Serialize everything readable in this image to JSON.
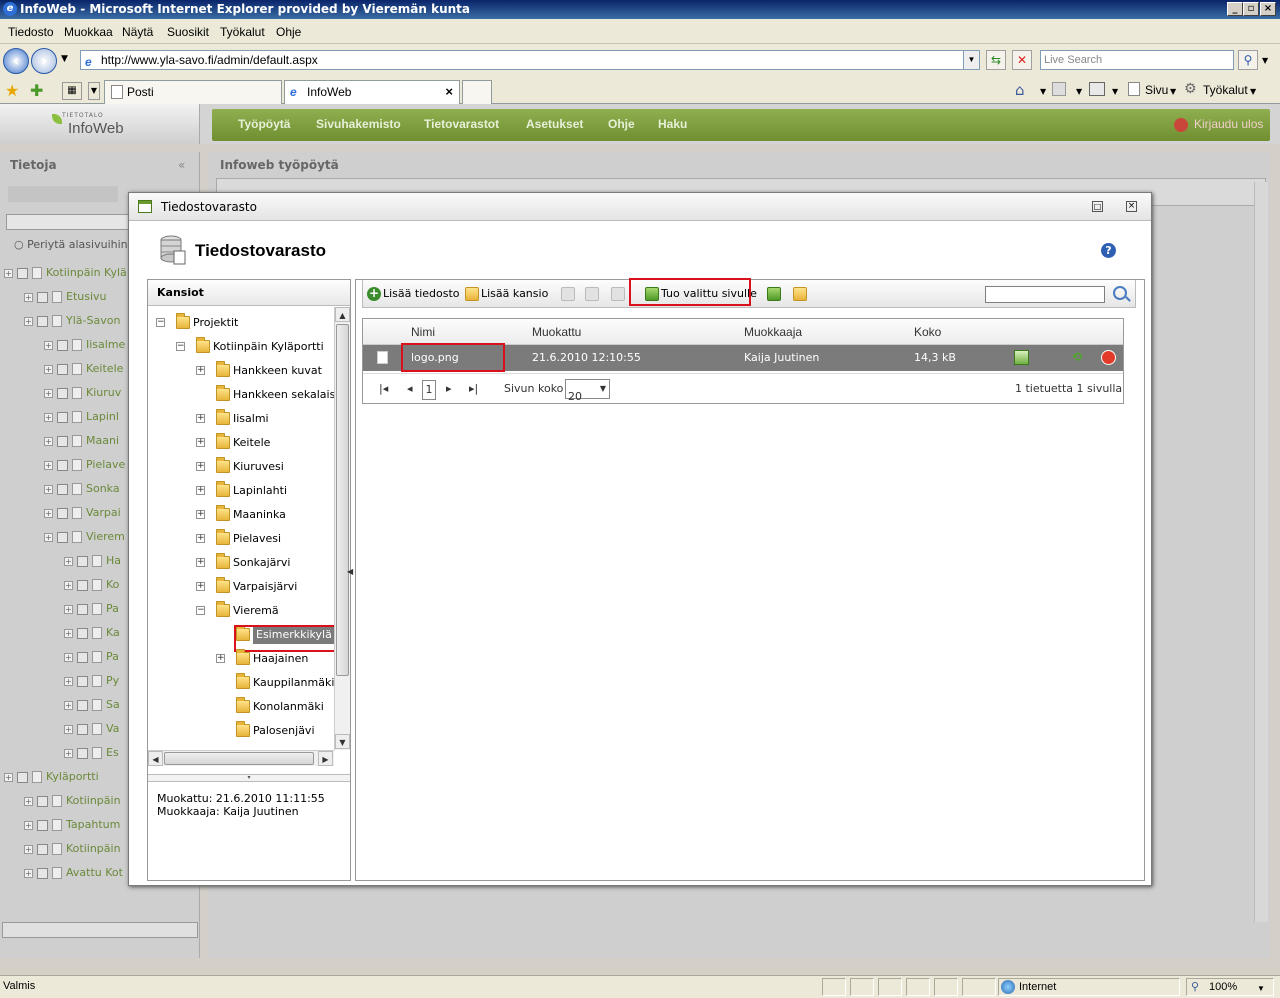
{
  "window": {
    "title": "InfoWeb - Microsoft Internet Explorer provided by Vieremän kunta"
  },
  "menu": [
    "Tiedosto",
    "Muokkaa",
    "Näytä",
    "Suosikit",
    "Työkalut",
    "Ohje"
  ],
  "address": {
    "url": "http://www.yla-savo.fi/admin/default.aspx",
    "search_placeholder": "Live Search"
  },
  "tabs": [
    {
      "label": "Posti"
    },
    {
      "label": "InfoWeb"
    }
  ],
  "ietools": {
    "page": "Sivu",
    "tools": "Työkalut"
  },
  "app": {
    "logo_small": "TIETOTALO",
    "logo_main": "InfoWeb",
    "nav": [
      "Työpöytä",
      "Sivuhakemisto",
      "Tietovarastot",
      "Asetukset",
      "Ohje",
      "Haku"
    ],
    "logout": "Kirjaudu ulos"
  },
  "leftpanel": {
    "title": "Tietoja",
    "inherit": "Periytä alasivuihin",
    "items": [
      "Kotiinpäin Kylä",
      "Etusivu",
      "Ylä-Savon",
      "Iisalme",
      "Keitele",
      "Kiuruv",
      "Lapinl",
      "Maani",
      "Pielave",
      "Sonka",
      "Varpai",
      "Vierem",
      "Ha",
      "Ko",
      "Pa",
      "Ka",
      "Pa",
      "Py",
      "Sa",
      "Va",
      "Es",
      "Kyläportti",
      "Kotiinpäin",
      "Tapahtum",
      "Kotiinpäin",
      "Avattu Kot"
    ]
  },
  "mainpanel": {
    "title": "Infoweb työpöytä"
  },
  "modal": {
    "window_title": "Tiedostovarasto",
    "title": "Tiedostovarasto",
    "folders_header": "Kansiot",
    "tree": [
      {
        "label": "Projektit"
      },
      {
        "label": "Kotiinpäin Kyläportti"
      },
      {
        "label": "Hankkeen kuvat"
      },
      {
        "label": "Hankkeen sekalaiset"
      },
      {
        "label": "Iisalmi"
      },
      {
        "label": "Keitele"
      },
      {
        "label": "Kiuruvesi"
      },
      {
        "label": "Lapinlahti"
      },
      {
        "label": "Maaninka"
      },
      {
        "label": "Pielavesi"
      },
      {
        "label": "Sonkajärvi"
      },
      {
        "label": "Varpaisjärvi"
      },
      {
        "label": "Vieremä"
      },
      {
        "label": "Esimerkkikylä"
      },
      {
        "label": "Haajainen"
      },
      {
        "label": "Kauppilanmäki"
      },
      {
        "label": "Konolanmäki"
      },
      {
        "label": "Palosenjävi"
      }
    ],
    "info_modified": "Muokattu: 21.6.2010 11:11:55",
    "info_editor": "Muokkaaja: Kaija Juutinen",
    "toolbar": {
      "add_file": "Lisää tiedosto",
      "add_folder": "Lisää kansio",
      "import": "Tuo valittu sivulle"
    },
    "grid": {
      "columns": [
        "Nimi",
        "Muokattu",
        "Muokkaaja",
        "Koko"
      ],
      "rows": [
        {
          "name": "logo.png",
          "modified": "21.6.2010 12:10:55",
          "editor": "Kaija Juutinen",
          "size": "14,3 kB"
        }
      ],
      "page": "1",
      "page_size_label": "Sivun koko",
      "page_size": "20",
      "summary": "1 tietuetta 1 sivulla"
    }
  },
  "status": {
    "left": "Valmis",
    "zone": "Internet",
    "zoom": "100%"
  }
}
